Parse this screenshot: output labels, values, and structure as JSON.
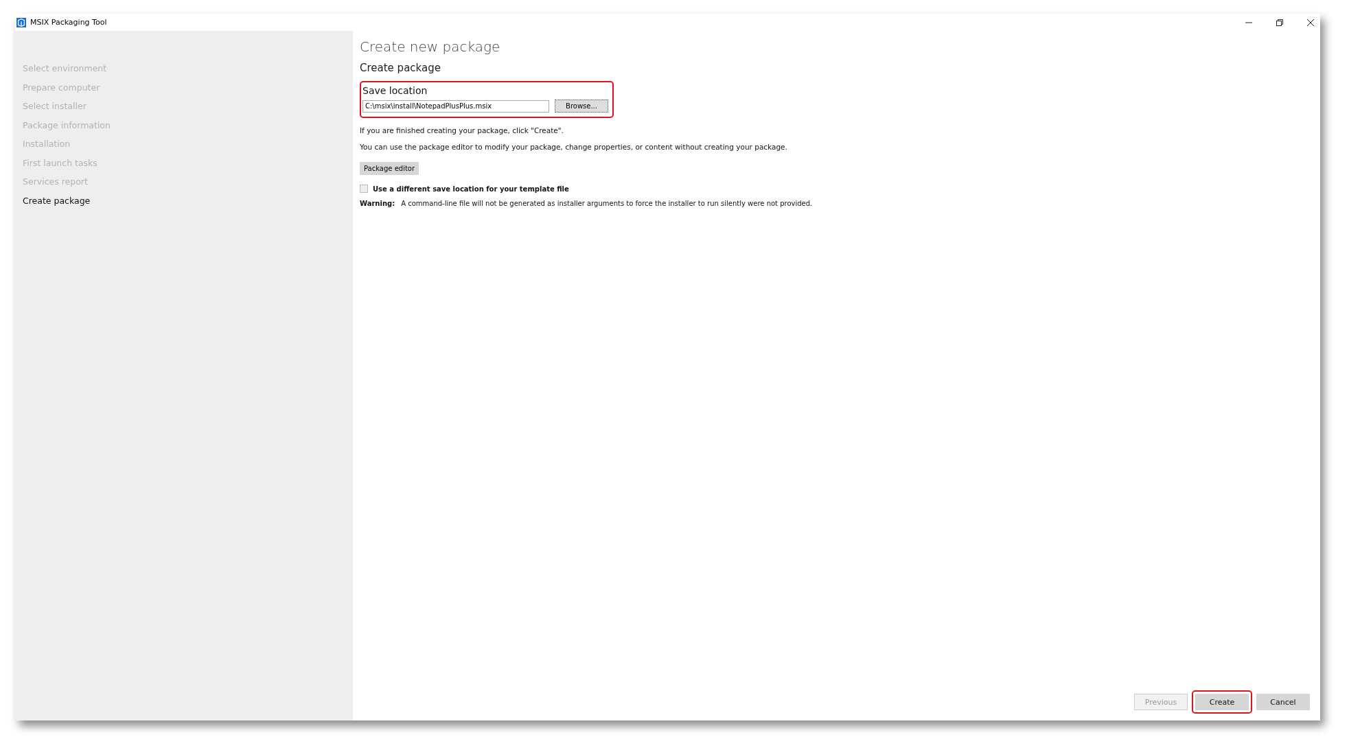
{
  "window": {
    "title": "MSIX Packaging Tool"
  },
  "sidebar": {
    "items": [
      {
        "label": "Select environment",
        "selected": false
      },
      {
        "label": "Prepare computer",
        "selected": false
      },
      {
        "label": "Select installer",
        "selected": false
      },
      {
        "label": "Package information",
        "selected": false
      },
      {
        "label": "Installation",
        "selected": false
      },
      {
        "label": "First launch tasks",
        "selected": false
      },
      {
        "label": "Services report",
        "selected": false
      },
      {
        "label": "Create package",
        "selected": true
      }
    ]
  },
  "main": {
    "title": "Create new package",
    "subtitle": "Create package",
    "save_location": {
      "label": "Save location",
      "value": "C:\\msix\\install\\NotepadPlusPlus.msix",
      "browse": "Browse...",
      "highlighted": true
    },
    "info": [
      "If you are finished creating your package, click \"Create\".",
      "You can use the package editor to modify your package, change properties, or content without creating your package."
    ],
    "package_editor": "Package editor",
    "template_checkbox": {
      "label": "Use a different save location for your template file",
      "checked": false
    },
    "warning": {
      "label": "Warning:",
      "text": "A command-line file will not be generated as installer arguments to force the installer to run silently were not provided."
    }
  },
  "footer": {
    "buttons": [
      {
        "label": "Previous",
        "disabled": true,
        "highlighted": false
      },
      {
        "label": "Create",
        "disabled": false,
        "highlighted": true
      },
      {
        "label": "Cancel",
        "disabled": false,
        "highlighted": false
      }
    ]
  }
}
